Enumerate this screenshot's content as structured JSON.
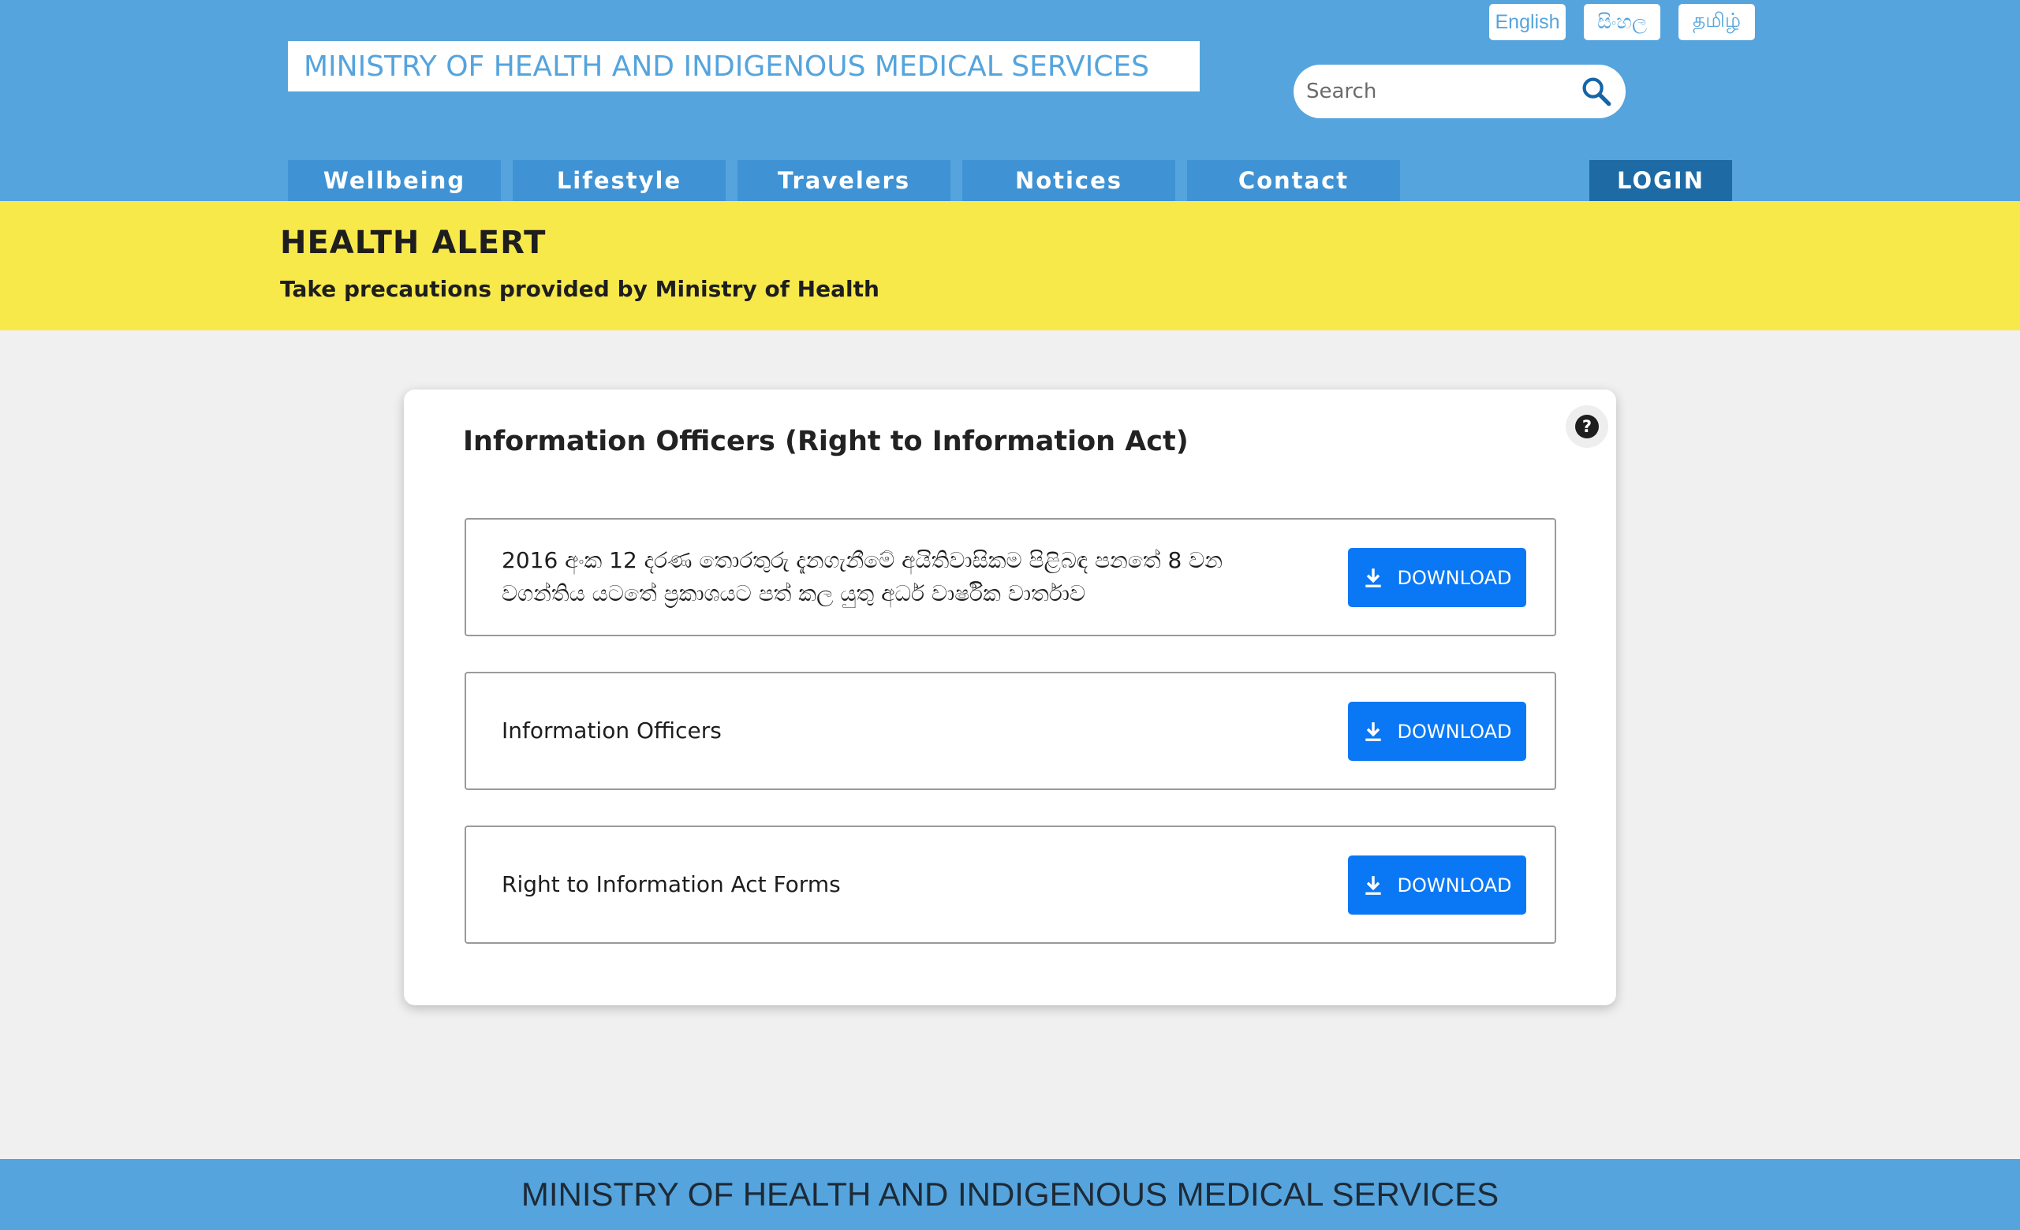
{
  "header": {
    "site_title": "MINISTRY OF HEALTH AND INDIGENOUS MEDICAL SERVICES",
    "languages": [
      "English",
      "සිංහල",
      "தமிழ்"
    ],
    "search": {
      "placeholder": "Search",
      "value": ""
    },
    "nav": [
      "Wellbeing",
      "Lifestyle",
      "Travelers",
      "Notices",
      "Contact"
    ],
    "login_label": "LOGIN",
    "colors": {
      "primary": "#55a4dd",
      "nav_tab": "#3f93d4",
      "login": "#1d6aa5"
    }
  },
  "alert": {
    "title": "HEALTH ALERT",
    "subtitle": "Take precautions provided by Ministry of Health",
    "color": "#f8e94b"
  },
  "main": {
    "title": "Information Officers (Right to Information Act)",
    "help_icon": "question-circle-icon",
    "documents": [
      {
        "label": "2016 අංක 12 දරණ තොරතුරු දැනගැනීමේ අයිතිවාසිකම පිළිබඳ පනතේ 8 වන වගන්තිය යටතේ ප්‍රකාශයට පත් කල යුතු අර්ධ වාර්ෂික වාර්තාව",
        "button": "DOWNLOAD"
      },
      {
        "label": "Information Officers",
        "button": "DOWNLOAD"
      },
      {
        "label": "Right to Information Act Forms",
        "button": "DOWNLOAD"
      }
    ],
    "download_icon": "download-icon",
    "button_color": "#0a78f5"
  },
  "footer": {
    "text": "MINISTRY OF HEALTH AND INDIGENOUS MEDICAL SERVICES"
  }
}
